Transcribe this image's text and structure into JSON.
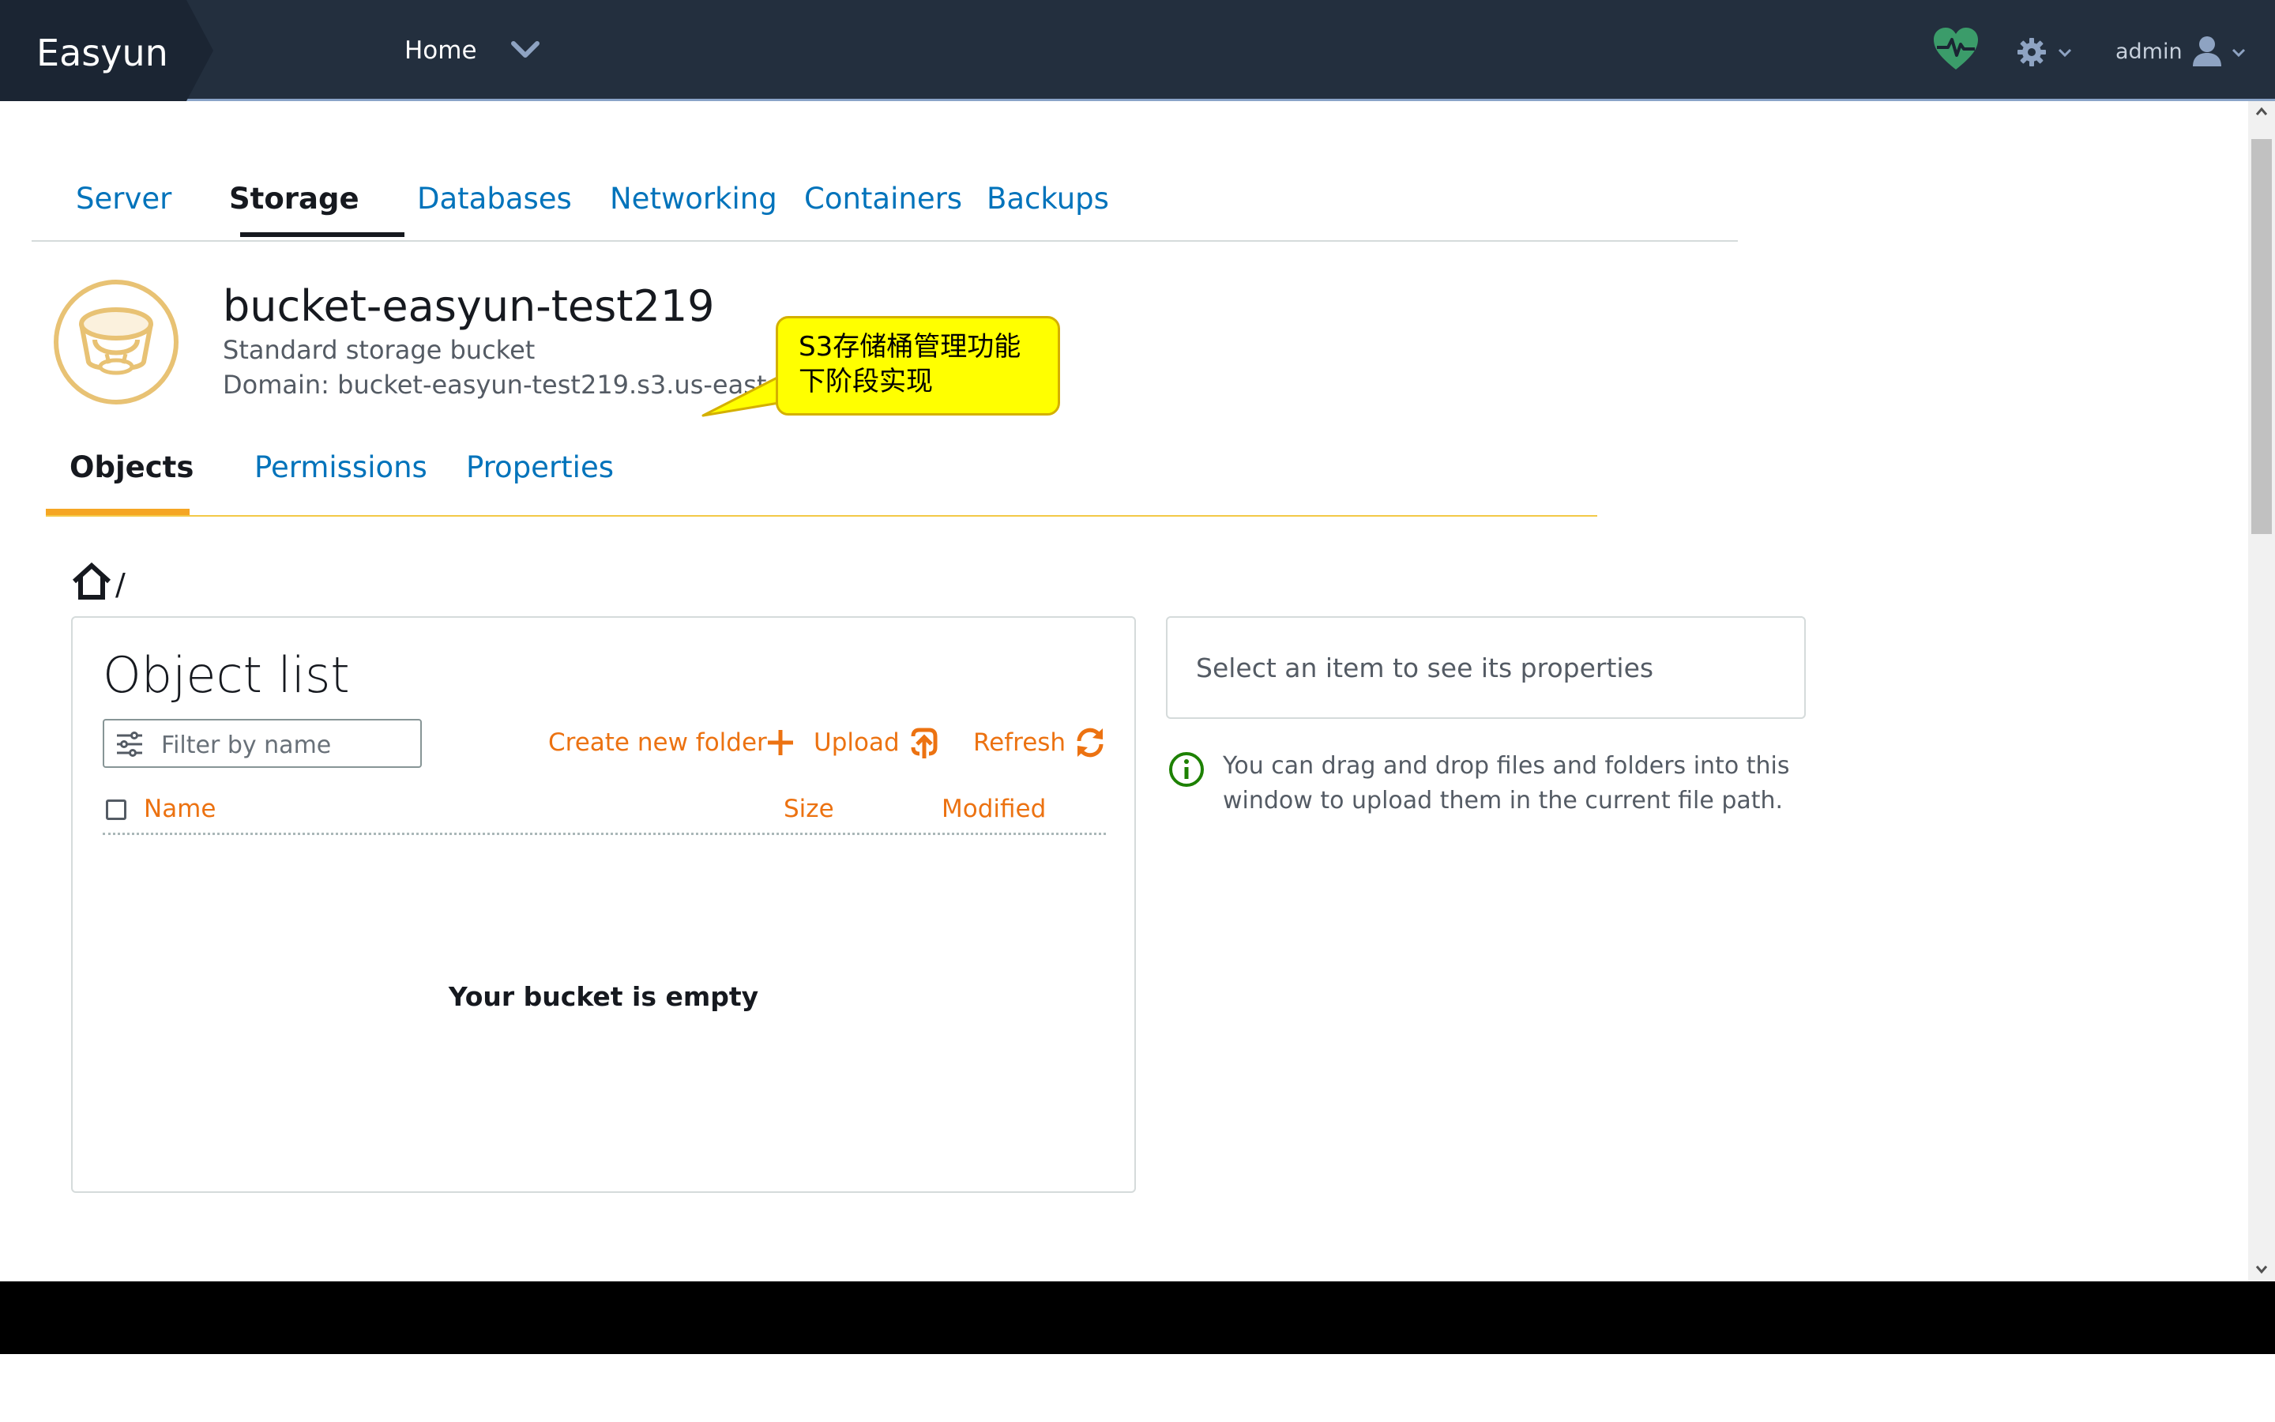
{
  "topbar": {
    "brand": "Easyun",
    "home_label": "Home",
    "admin_label": "admin",
    "icons": [
      "chevron-down-icon",
      "heartbeat-icon",
      "gear-icon",
      "user-icon"
    ],
    "bg_color": "#232f3e",
    "health_color": "#3b9c6a"
  },
  "main_tabs": [
    {
      "label": "Server",
      "active": false
    },
    {
      "label": "Storage",
      "active": true
    },
    {
      "label": "Databases",
      "active": false
    },
    {
      "label": "Networking",
      "active": false
    },
    {
      "label": "Containers",
      "active": false
    },
    {
      "label": "Backups",
      "active": false
    }
  ],
  "bucket": {
    "name": "bucket-easyun-test219",
    "subtitle": "Standard storage bucket",
    "domain": "Domain: bucket-easyun-test219.s3.us-east",
    "icon": "bucket-icon",
    "icon_color": "#e8c274"
  },
  "callout": {
    "line1": "S3存储桶管理功能",
    "line2": "下阶段实现",
    "color": "#ffff00"
  },
  "sub_tabs": [
    {
      "label": "Objects",
      "active": true
    },
    {
      "label": "Permissions",
      "active": false
    },
    {
      "label": "Properties",
      "active": false
    }
  ],
  "breadcrumb": {
    "icon": "home-icon",
    "separator": "/"
  },
  "object_list": {
    "title": "Object list",
    "filter_placeholder": "Filter by name",
    "actions": {
      "create_folder": "Create new folder",
      "upload": "Upload",
      "refresh": "Refresh"
    },
    "columns": {
      "name": "Name",
      "size": "Size",
      "modified": "Modified"
    },
    "empty_message": "Your bucket is empty",
    "accent_color": "#ec7211"
  },
  "properties": {
    "placeholder": "Select an item to see its properties",
    "info_line1": "You can drag and drop files and folders into this",
    "info_line2": "window to upload them in the current file path.",
    "info_color": "#1d8102"
  }
}
